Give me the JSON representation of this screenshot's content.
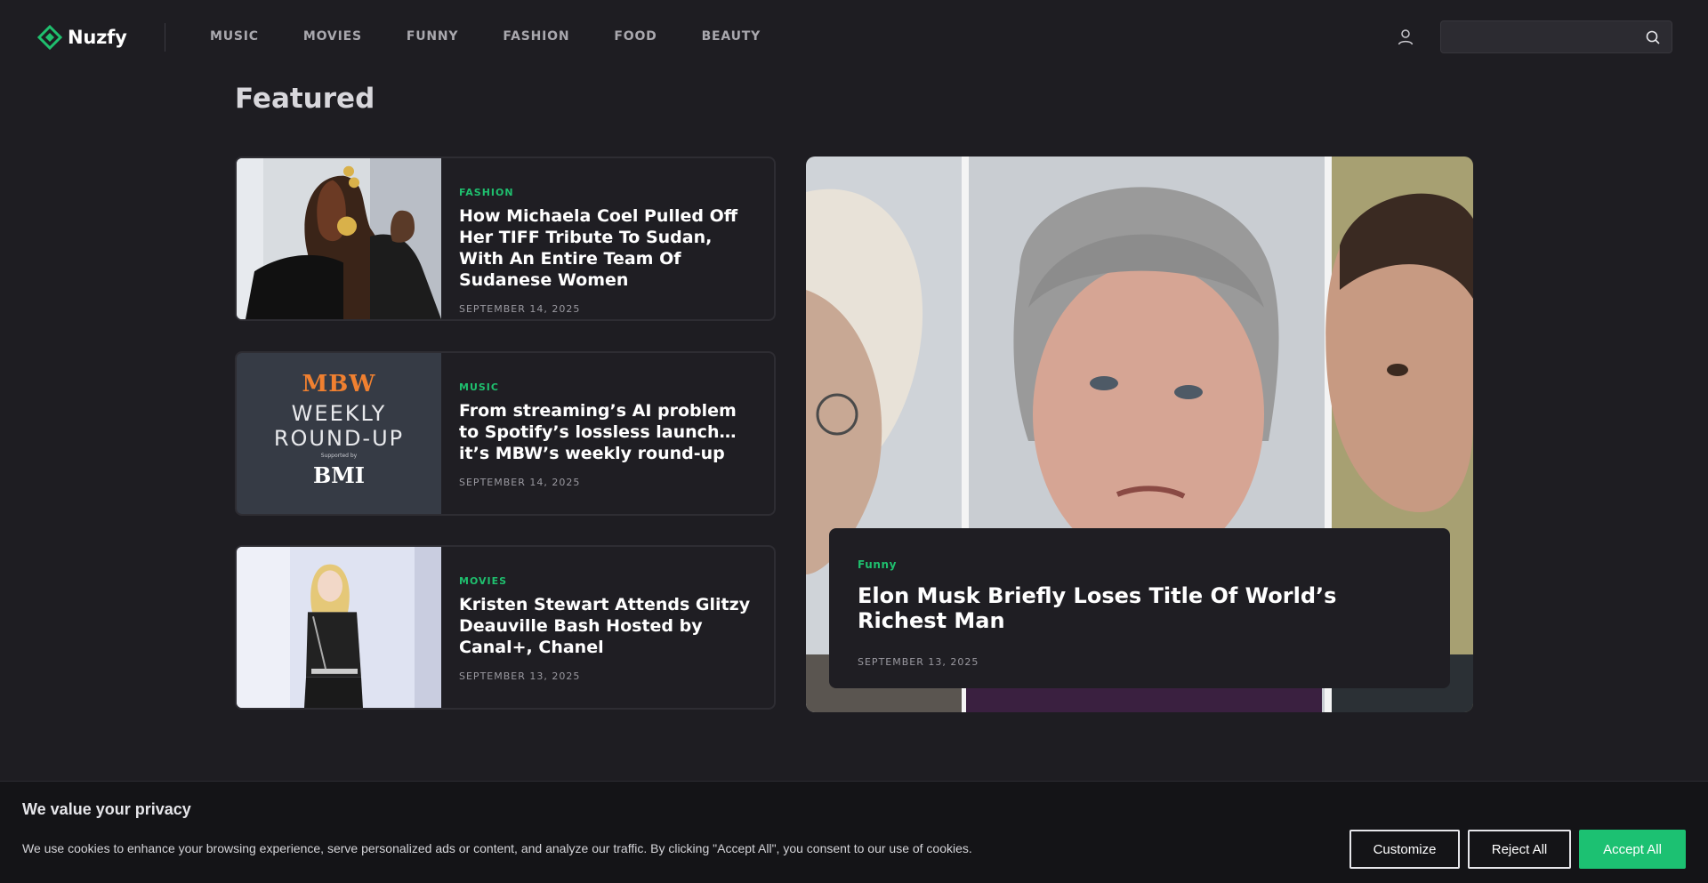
{
  "site": {
    "name": "Nuzfy",
    "accent_color": "#1fbf6e"
  },
  "nav": {
    "items": [
      "MUSIC",
      "MOVIES",
      "FUNNY",
      "FASHION",
      "FOOD",
      "BEAUTY"
    ]
  },
  "header": {
    "user_icon": "user-icon",
    "search_icon": "search-icon",
    "search_value": ""
  },
  "featured": {
    "title": "Featured",
    "cards": [
      {
        "category": "FASHION",
        "title": "How Michaela Coel Pulled Off Her TIFF Tribute To Sudan, With An Entire Team Of Sudanese Women",
        "date": "SEPTEMBER 14, 2025"
      },
      {
        "category": "MUSIC",
        "title": "From streaming’s AI problem to Spotify’s lossless launch… it’s MBW’s weekly round-up",
        "date": "SEPTEMBER 14, 2025",
        "thumb_logo": "MBW",
        "thumb_line1": "WEEKLY",
        "thumb_line2": "ROUND-UP",
        "thumb_supported": "Supported by",
        "thumb_sponsor": "BMI"
      },
      {
        "category": "MOVIES",
        "title": "Kristen Stewart Attends Glitzy Deauville Bash Hosted by Canal+, Chanel",
        "date": "SEPTEMBER 13, 2025"
      }
    ],
    "hero": {
      "category": "Funny",
      "title": "Elon Musk Briefly Loses Title Of World’s Richest Man",
      "date": "SEPTEMBER 13, 2025"
    }
  },
  "cookie": {
    "title": "We value your privacy",
    "text": "We use cookies to enhance your browsing experience, serve personalized ads or content, and analyze our traffic. By clicking \"Accept All\", you consent to our use of cookies.",
    "customize": "Customize",
    "reject": "Reject All",
    "accept": "Accept All",
    "accept_color": "#1cc172"
  }
}
